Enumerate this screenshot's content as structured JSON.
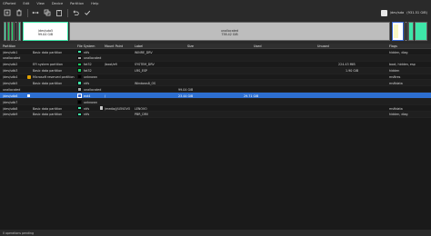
{
  "menu": [
    "GParted",
    "Edit",
    "View",
    "Device",
    "Partition",
    "Help"
  ],
  "toolbar": {
    "icons": [
      "new-partition-icon",
      "delete-icon",
      "resize-icon",
      "copy-icon",
      "paste-icon",
      "undo-icon",
      "apply-icon"
    ]
  },
  "device": {
    "name": "/dev/sda",
    "size": "(931.51 GiB)"
  },
  "visual": [
    {
      "name": "/dev/sda5",
      "size": "99.04 GiB",
      "color": "#c0c0c0"
    },
    {
      "name": "unallocated",
      "size": "738.42 GiB",
      "color": "#bcbcbc"
    }
  ],
  "columns": [
    "Partition",
    "File System",
    "Mount Point",
    "Label",
    "Size",
    "Used",
    "Unused",
    "Flags"
  ],
  "rows": [
    {
      "partition": "/dev/sdb1",
      "warn": false,
      "name": "Basic data partition",
      "fs": "ntfs",
      "fscolor": "#3ee6a9",
      "mount": "",
      "label": "WINRE_DRV",
      "size": "",
      "used": "",
      "unused": "",
      "flags": "hidden, diag"
    },
    {
      "partition": "unallocated",
      "warn": false,
      "name": "",
      "fs": "unallocated",
      "fscolor": "#a8a8a8",
      "mount": "",
      "label": "",
      "size": "",
      "used": "",
      "unused": "",
      "flags": ""
    },
    {
      "partition": "/dev/sdb2",
      "warn": false,
      "name": "EFI system partition",
      "fs": "fat32",
      "fscolor": "#19d162",
      "mount": "/boot/efi",
      "label": "SYSTEM_DRV",
      "size": "",
      "used": "",
      "unused": "224.43 MiB",
      "flags": "boot, hidden, esp"
    },
    {
      "partition": "/dev/sdb3",
      "warn": false,
      "name": "Basic data partition",
      "fs": "fat32",
      "fscolor": "#19d162",
      "mount": "",
      "label": "LRS_ESP",
      "size": "",
      "used": "",
      "unused": "1.90 GiB",
      "flags": "hidden"
    },
    {
      "partition": "/dev/sdb4",
      "warn": true,
      "name": "Microsoft reserved partition",
      "fs": "unknown",
      "fscolor": "#000000",
      "mount": "",
      "label": "",
      "size": "",
      "used": "",
      "unused": "",
      "flags": "msftres"
    },
    {
      "partition": "/dev/sdb5",
      "warn": false,
      "name": "Basic data partition",
      "fs": "ntfs",
      "fscolor": "#3ee6a9",
      "mount": "",
      "label": "Windows8_OS",
      "size": "",
      "used": "",
      "unused": "",
      "flags": "msftdata"
    },
    {
      "partition": "unallocated",
      "warn": false,
      "name": "",
      "fs": "unallocated",
      "fscolor": "#a8a8a8",
      "mount": "",
      "label": "",
      "size": "99.04 GiB",
      "used": "",
      "unused": "",
      "flags": ""
    },
    {
      "partition": "/dev/sdb6",
      "warn": false,
      "name": "",
      "fs": "ext4",
      "fscolor": "#3b6bd3",
      "mount": "/",
      "label": "",
      "size": "23.44 GiB",
      "used": "29.71 GiB",
      "unused": "",
      "flags": "",
      "selected": true,
      "lock": true
    },
    {
      "partition": "/dev/sdb7",
      "warn": false,
      "name": "",
      "fs": "unknown",
      "fscolor": "#000000",
      "mount": "",
      "label": "",
      "size": "",
      "used": "",
      "unused": "",
      "flags": ""
    },
    {
      "partition": "/dev/sdb8",
      "warn": false,
      "name": "Basic data partition",
      "fs": "ntfs",
      "fscolor": "#3ee6a9",
      "mount": "/media/j/LENOVO",
      "label": "LENOVO",
      "size": "",
      "used": "",
      "unused": "",
      "flags": "msftdata",
      "lock": true
    },
    {
      "partition": "/dev/sdb9",
      "warn": false,
      "name": "Basic data partition",
      "fs": "ntfs",
      "fscolor": "#3ee6a9",
      "mount": "",
      "label": "PBR_DRV",
      "size": "",
      "used": "",
      "unused": "",
      "flags": "hidden, diag"
    }
  ],
  "status": "0 operations pending"
}
